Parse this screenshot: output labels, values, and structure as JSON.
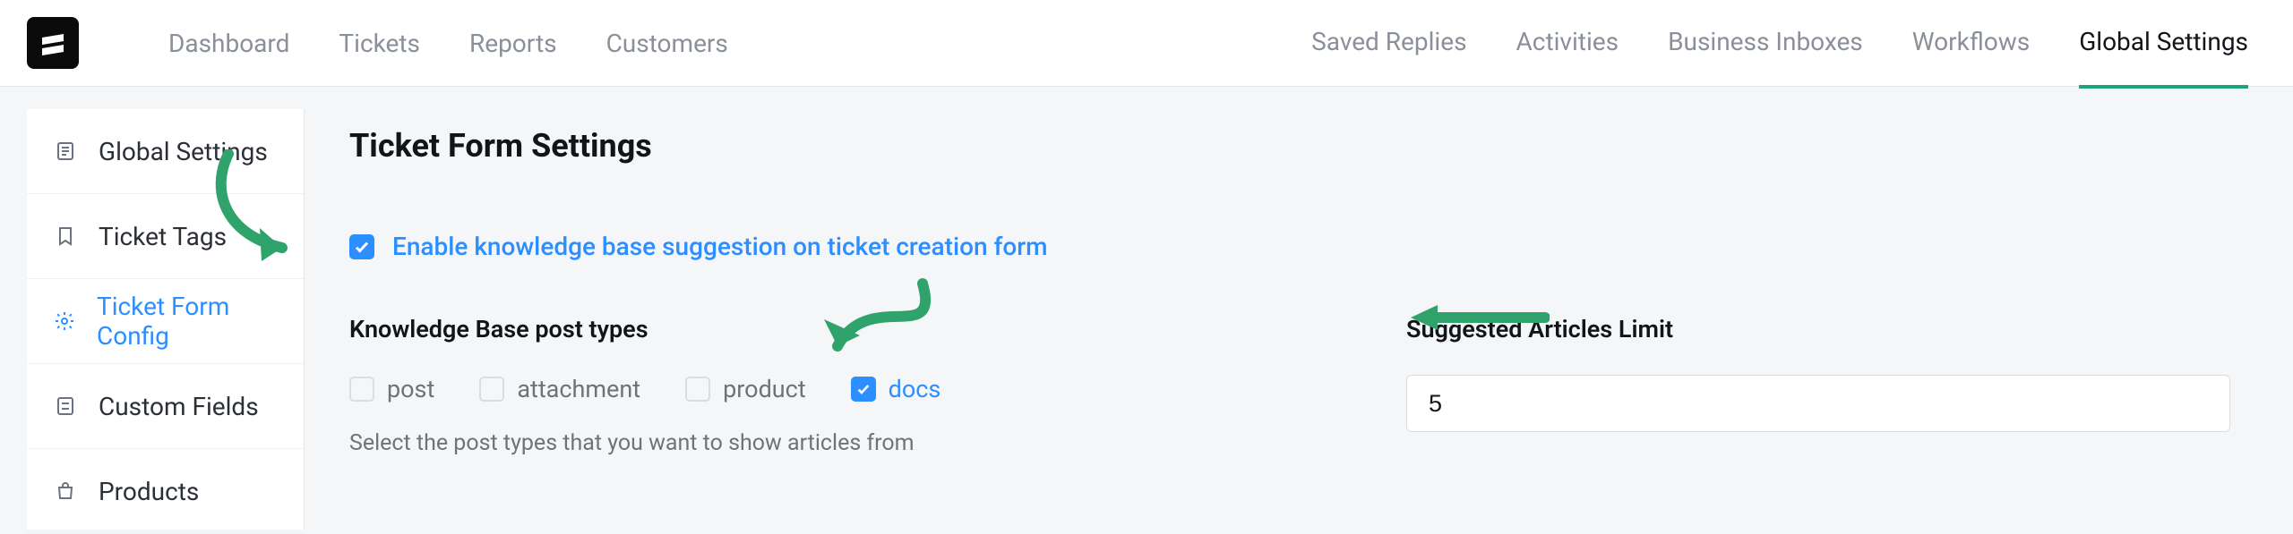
{
  "nav": {
    "left": [
      "Dashboard",
      "Tickets",
      "Reports",
      "Customers"
    ],
    "right": [
      "Saved Replies",
      "Activities",
      "Business Inboxes",
      "Workflows",
      "Global Settings"
    ],
    "active": "Global Settings"
  },
  "sidebar": {
    "items": [
      {
        "label": "Global Settings",
        "icon": "file-icon"
      },
      {
        "label": "Ticket Tags",
        "icon": "bookmark-icon"
      },
      {
        "label": "Ticket Form Config",
        "icon": "gear-icon",
        "active": true
      },
      {
        "label": "Custom Fields",
        "icon": "list-icon"
      },
      {
        "label": "Products",
        "icon": "bag-icon"
      }
    ]
  },
  "main": {
    "title": "Ticket Form Settings",
    "enable": {
      "label": "Enable knowledge base suggestion on ticket creation form",
      "checked": true
    },
    "posttypes": {
      "heading": "Knowledge Base post types",
      "options": [
        {
          "label": "post",
          "checked": false
        },
        {
          "label": "attachment",
          "checked": false
        },
        {
          "label": "product",
          "checked": false
        },
        {
          "label": "docs",
          "checked": true
        }
      ],
      "helper": "Select the post types that you want to show articles from"
    },
    "limit": {
      "heading": "Suggested Articles Limit",
      "value": "5"
    }
  },
  "colors": {
    "accent": "#2d8eff",
    "annotation": "#2fa36b"
  }
}
